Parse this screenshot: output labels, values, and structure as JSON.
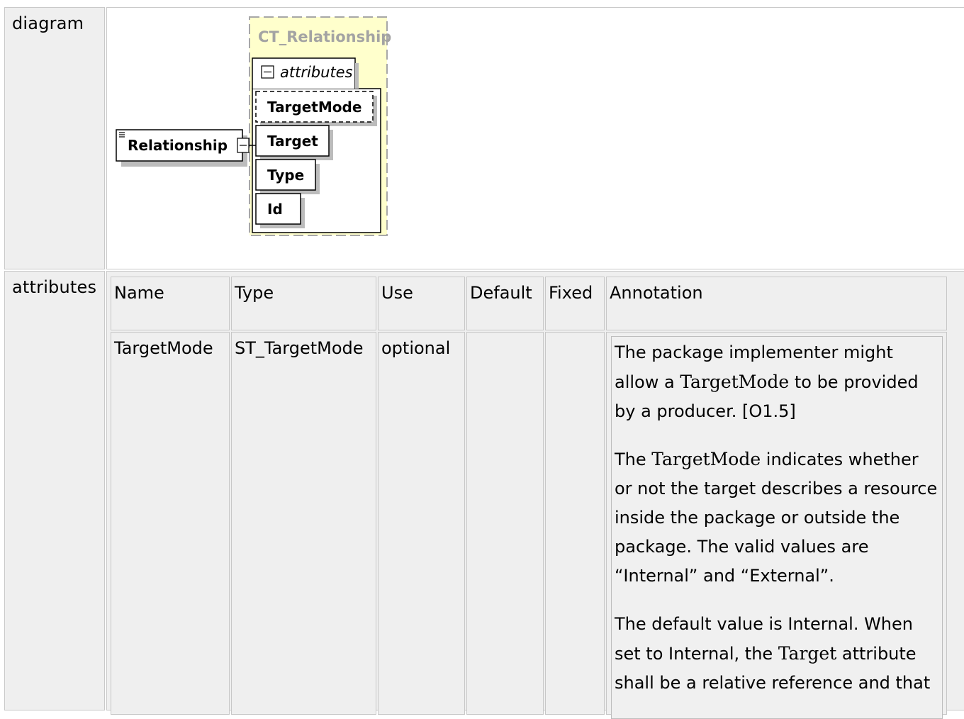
{
  "rows": {
    "diagram_label": "diagram",
    "attributes_label": "attributes"
  },
  "diagram": {
    "element_name": "Relationship",
    "complex_type": "CT_Relationship",
    "group_label": "attributes",
    "attributes": [
      "TargetMode",
      "Target",
      "Type",
      "Id"
    ]
  },
  "attributes_table": {
    "headers": [
      "Name",
      "Type",
      "Use",
      "Default",
      "Fixed",
      "Annotation"
    ],
    "rows": [
      {
        "name": "TargetMode",
        "type": "ST_TargetMode",
        "use": "optional",
        "default": "",
        "fixed": "",
        "annotation": {
          "p1_a": "The package implementer might allow a ",
          "p1_code": "TargetMode",
          "p1_b": " to be provided by a producer. [O1.5]",
          "p2_a": "The ",
          "p2_code": "TargetMode",
          "p2_b": " indicates whether or not the target describes a resource inside the package or outside the package. The valid values are “Internal” and “External”.",
          "p3_a": "The default value is Internal. When set to Internal, the ",
          "p3_code": "Target",
          "p3_b": " attribute shall be a relative reference and that"
        }
      }
    ]
  }
}
